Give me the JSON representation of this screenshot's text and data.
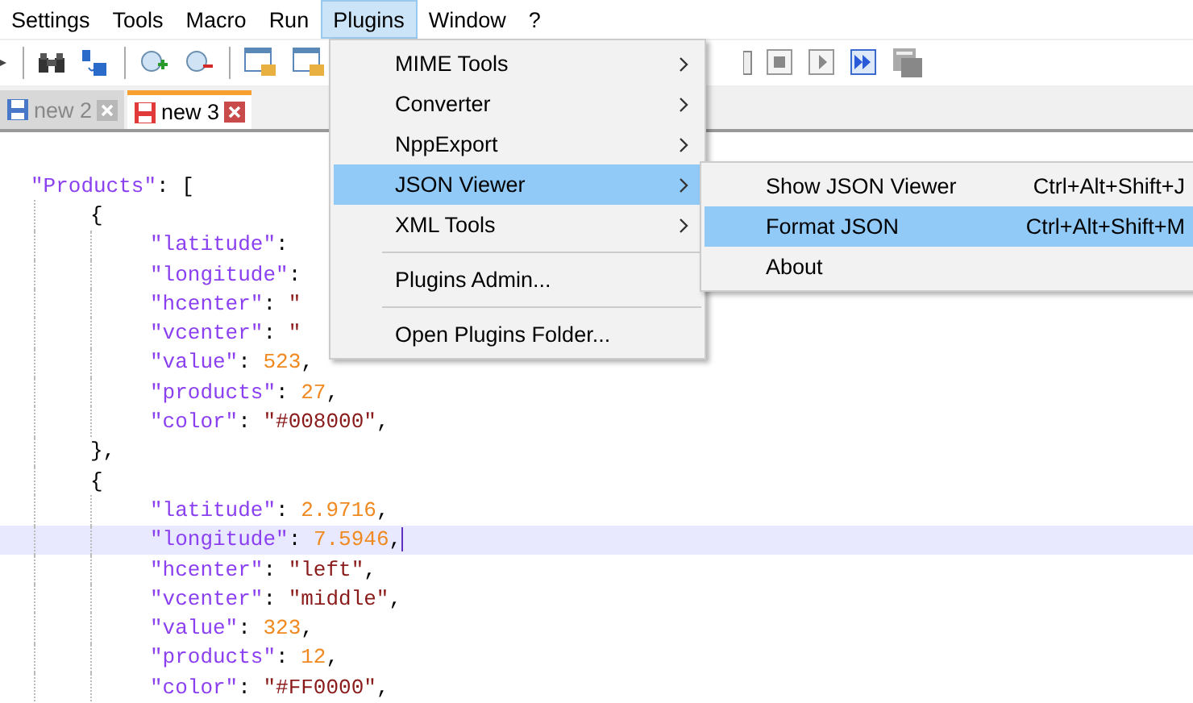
{
  "menubar": [
    {
      "label": "Settings",
      "selected": false
    },
    {
      "label": "Tools",
      "selected": false
    },
    {
      "label": "Macro",
      "selected": false
    },
    {
      "label": "Run",
      "selected": false
    },
    {
      "label": "Plugins",
      "selected": true
    },
    {
      "label": "Window",
      "selected": false
    },
    {
      "label": "?",
      "selected": false
    }
  ],
  "tabs": [
    {
      "label": "new 2",
      "selected": false,
      "modified": false
    },
    {
      "label": "new 3",
      "selected": true,
      "modified": true
    }
  ],
  "editor": {
    "lines": [
      {
        "tokens": [
          {
            "kind": "key",
            "text": "\"Products\""
          },
          {
            "kind": "punct",
            "text": ": ["
          }
        ],
        "current": false,
        "children": [
          {
            "tokens": [
              {
                "kind": "punct",
                "text": "{"
              }
            ],
            "current": false,
            "children": [
              {
                "tokens": [
                  {
                    "kind": "key",
                    "text": "\"latitude\""
                  },
                  {
                    "kind": "punct",
                    "text": ":"
                  }
                ],
                "current": false
              },
              {
                "tokens": [
                  {
                    "kind": "key",
                    "text": "\"longitude\""
                  },
                  {
                    "kind": "punct",
                    "text": ":"
                  }
                ],
                "current": false
              },
              {
                "tokens": [
                  {
                    "kind": "key",
                    "text": "\"hcenter\""
                  },
                  {
                    "kind": "punct",
                    "text": ":"
                  },
                  {
                    "kind": "string",
                    "text": " \""
                  }
                ],
                "current": false
              },
              {
                "tokens": [
                  {
                    "kind": "key",
                    "text": "\"vcenter\""
                  },
                  {
                    "kind": "punct",
                    "text": ":"
                  },
                  {
                    "kind": "string",
                    "text": " \""
                  }
                ],
                "current": false
              },
              {
                "tokens": [
                  {
                    "kind": "key",
                    "text": "\"value\""
                  },
                  {
                    "kind": "punct",
                    "text": ": "
                  },
                  {
                    "kind": "number",
                    "text": "523"
                  },
                  {
                    "kind": "punct",
                    "text": ","
                  }
                ],
                "current": false
              },
              {
                "tokens": [
                  {
                    "kind": "key",
                    "text": "\"products\""
                  },
                  {
                    "kind": "punct",
                    "text": ": "
                  },
                  {
                    "kind": "number",
                    "text": "27"
                  },
                  {
                    "kind": "punct",
                    "text": ","
                  }
                ],
                "current": false
              },
              {
                "tokens": [
                  {
                    "kind": "key",
                    "text": "\"color\""
                  },
                  {
                    "kind": "punct",
                    "text": ": "
                  },
                  {
                    "kind": "string",
                    "text": "\"#008000\""
                  },
                  {
                    "kind": "punct",
                    "text": ","
                  }
                ],
                "current": false
              }
            ]
          },
          {
            "tokens": [
              {
                "kind": "punct",
                "text": "},"
              }
            ],
            "current": false
          },
          {
            "tokens": [
              {
                "kind": "punct",
                "text": "{"
              }
            ],
            "current": false,
            "children": [
              {
                "tokens": [
                  {
                    "kind": "key",
                    "text": "\"latitude\""
                  },
                  {
                    "kind": "punct",
                    "text": ": "
                  },
                  {
                    "kind": "number",
                    "text": "2.9716"
                  },
                  {
                    "kind": "punct",
                    "text": ","
                  }
                ],
                "current": false
              },
              {
                "tokens": [
                  {
                    "kind": "key",
                    "text": "\"longitude\""
                  },
                  {
                    "kind": "punct",
                    "text": ": "
                  },
                  {
                    "kind": "number",
                    "text": "7.5946"
                  },
                  {
                    "kind": "punct",
                    "text": ","
                  }
                ],
                "current": true
              },
              {
                "tokens": [
                  {
                    "kind": "key",
                    "text": "\"hcenter\""
                  },
                  {
                    "kind": "punct",
                    "text": ": "
                  },
                  {
                    "kind": "string",
                    "text": "\"left\""
                  },
                  {
                    "kind": "punct",
                    "text": ","
                  }
                ],
                "current": false
              },
              {
                "tokens": [
                  {
                    "kind": "key",
                    "text": "\"vcenter\""
                  },
                  {
                    "kind": "punct",
                    "text": ": "
                  },
                  {
                    "kind": "string",
                    "text": "\"middle\""
                  },
                  {
                    "kind": "punct",
                    "text": ","
                  }
                ],
                "current": false
              },
              {
                "tokens": [
                  {
                    "kind": "key",
                    "text": "\"value\""
                  },
                  {
                    "kind": "punct",
                    "text": ": "
                  },
                  {
                    "kind": "number",
                    "text": "323"
                  },
                  {
                    "kind": "punct",
                    "text": ","
                  }
                ],
                "current": false
              },
              {
                "tokens": [
                  {
                    "kind": "key",
                    "text": "\"products\""
                  },
                  {
                    "kind": "punct",
                    "text": ": "
                  },
                  {
                    "kind": "number",
                    "text": "12"
                  },
                  {
                    "kind": "punct",
                    "text": ","
                  }
                ],
                "current": false
              },
              {
                "tokens": [
                  {
                    "kind": "key",
                    "text": "\"color\""
                  },
                  {
                    "kind": "punct",
                    "text": ": "
                  },
                  {
                    "kind": "string",
                    "text": "\"#FF0000\""
                  },
                  {
                    "kind": "punct",
                    "text": ","
                  }
                ],
                "current": false
              }
            ]
          }
        ]
      }
    ]
  },
  "plugins_menu": {
    "items": [
      {
        "kind": "item",
        "label": "MIME Tools",
        "submenu": true,
        "selected": false
      },
      {
        "kind": "item",
        "label": "Converter",
        "submenu": true,
        "selected": false
      },
      {
        "kind": "item",
        "label": "NppExport",
        "submenu": true,
        "selected": false
      },
      {
        "kind": "item",
        "label": "JSON Viewer",
        "submenu": true,
        "selected": true
      },
      {
        "kind": "item",
        "label": "XML Tools",
        "submenu": true,
        "selected": false
      },
      {
        "kind": "separator"
      },
      {
        "kind": "item",
        "label": "Plugins Admin...",
        "submenu": false,
        "selected": false
      },
      {
        "kind": "separator"
      },
      {
        "kind": "item",
        "label": "Open Plugins Folder...",
        "submenu": false,
        "selected": false
      }
    ]
  },
  "json_viewer_submenu": {
    "items": [
      {
        "label": "Show JSON Viewer",
        "shortcut": "Ctrl+Alt+Shift+J",
        "selected": false
      },
      {
        "label": "Format JSON",
        "shortcut": "Ctrl+Alt+Shift+M",
        "selected": true
      },
      {
        "label": "About",
        "selected": false
      }
    ]
  }
}
